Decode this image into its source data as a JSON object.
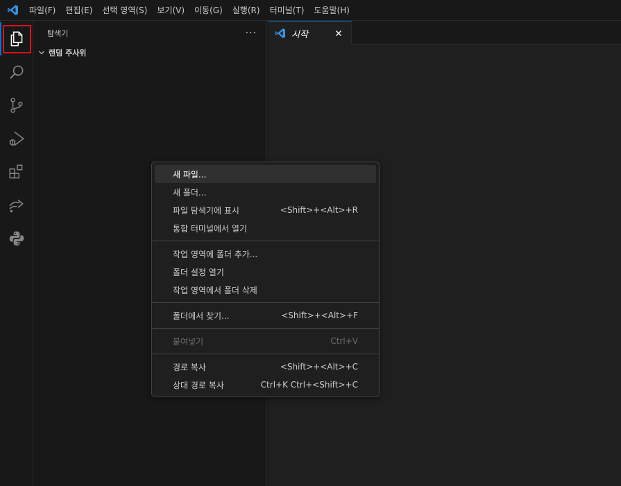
{
  "menubar": {
    "items": [
      "파일(F)",
      "편집(E)",
      "선택 영역(S)",
      "보기(V)",
      "이동(G)",
      "실행(R)",
      "터미널(T)",
      "도움말(H)"
    ]
  },
  "activitybar": {
    "icons": [
      "explorer-icon",
      "search-icon",
      "source-control-icon",
      "run-debug-icon",
      "extensions-icon",
      "remote-explorer-icon",
      "python-icon"
    ]
  },
  "sidebar": {
    "title": "탐색기",
    "more": "···",
    "section_title": "랜덤 주사위"
  },
  "editor": {
    "tab_label": "시작"
  },
  "context_menu": {
    "groups": [
      [
        {
          "label": "새 파일...",
          "shortcut": ""
        },
        {
          "label": "새 폴더...",
          "shortcut": ""
        },
        {
          "label": "파일 탐색기에 표시",
          "shortcut": "<Shift>+<Alt>+R"
        },
        {
          "label": "통합 터미널에서 열기",
          "shortcut": ""
        }
      ],
      [
        {
          "label": "작업 영역에 폴더 추가...",
          "shortcut": ""
        },
        {
          "label": "폴더 설정 열기",
          "shortcut": ""
        },
        {
          "label": "작업 영역에서 폴더 삭제",
          "shortcut": ""
        }
      ],
      [
        {
          "label": "폴더에서 찾기...",
          "shortcut": "<Shift>+<Alt>+F"
        }
      ],
      [
        {
          "label": "붙여넣기",
          "shortcut": "Ctrl+V"
        }
      ],
      [
        {
          "label": "경로 복사",
          "shortcut": "<Shift>+<Alt>+C"
        },
        {
          "label": "상대 경로 복사",
          "shortcut": "Ctrl+K Ctrl+<Shift>+C"
        }
      ]
    ]
  },
  "colors": {
    "accent": "#0078d4",
    "highlight_box": "#e0101a",
    "vscode_blue": "#3794e3"
  }
}
